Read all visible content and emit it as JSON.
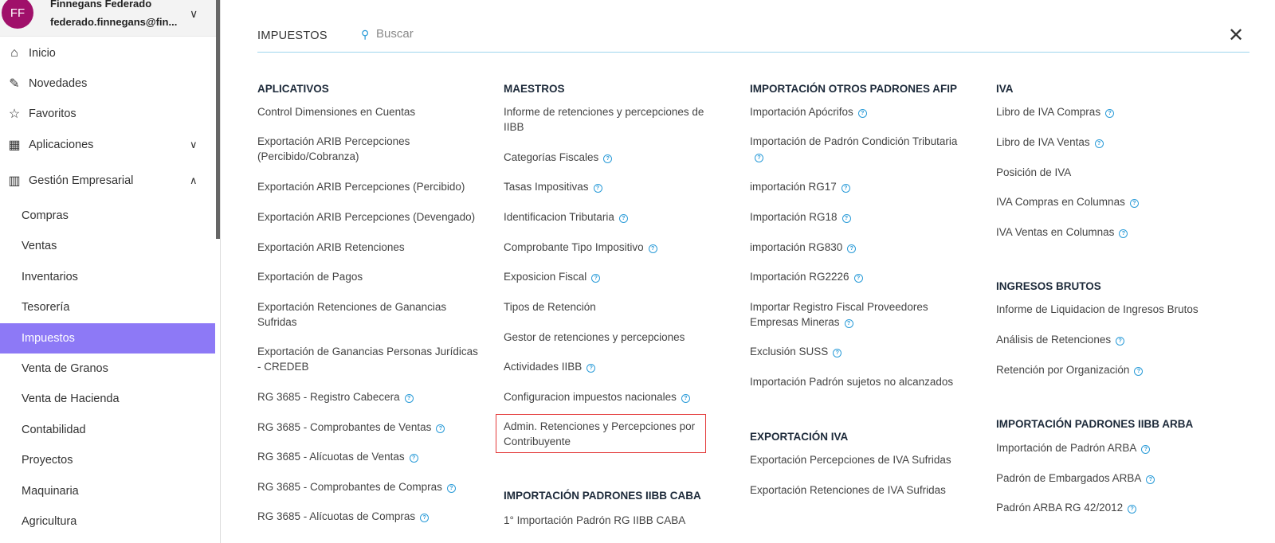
{
  "user": {
    "initials": "FF",
    "name": "Finnegans Federado",
    "email": "federado.finnegans@fin..."
  },
  "nav": [
    {
      "label": "Inicio",
      "icon": "home-icon",
      "glyph": "⌂"
    },
    {
      "label": "Novedades",
      "icon": "pin-icon",
      "glyph": "✎"
    },
    {
      "label": "Favoritos",
      "icon": "star-icon",
      "glyph": "☆"
    },
    {
      "label": "Aplicaciones",
      "icon": "grid-icon",
      "glyph": "▦",
      "chev": "∨"
    },
    {
      "label": "Gestión Empresarial",
      "icon": "building-icon",
      "glyph": "▥",
      "chev": "∧"
    }
  ],
  "subnav": [
    "Compras",
    "Ventas",
    "Inventarios",
    "Tesorería",
    "Impuestos",
    "Venta de Granos",
    "Venta de Hacienda",
    "Contabilidad",
    "Proyectos",
    "Maquinaria",
    "Agricultura"
  ],
  "active_subnav": "Impuestos",
  "header": {
    "title": "IMPUESTOS",
    "search_placeholder": "Buscar",
    "close": "✕"
  },
  "columns": [
    {
      "sections": [
        {
          "title": "APLICATIVOS",
          "items": [
            {
              "label": "Control Dimensiones en Cuentas",
              "help": false
            },
            {
              "label": "Exportación ARIB Percepciones (Percibido/Cobranza)",
              "help": false
            },
            {
              "label": "Exportación ARIB Percepciones (Percibido)",
              "help": false
            },
            {
              "label": "Exportación ARIB Percepciones (Devengado)",
              "help": false
            },
            {
              "label": "Exportación ARIB Retenciones",
              "help": false
            },
            {
              "label": "Exportación de Pagos",
              "help": false
            },
            {
              "label": "Exportación Retenciones de Ganancias Sufridas",
              "help": false
            },
            {
              "label": "Exportación de Ganancias Personas Jurídicas - CREDEB",
              "help": false
            },
            {
              "label": "RG 3685 - Registro Cabecera",
              "help": true
            },
            {
              "label": "RG 3685 - Comprobantes de Ventas",
              "help": true
            },
            {
              "label": "RG 3685 - Alícuotas de Ventas",
              "help": true
            },
            {
              "label": "RG 3685 - Comprobantes de Compras",
              "help": true
            },
            {
              "label": "RG 3685 - Alícuotas de Compras",
              "help": true
            }
          ]
        }
      ]
    },
    {
      "sections": [
        {
          "title": "MAESTROS",
          "items": [
            {
              "label": "Informe de retenciones y percepciones de IIBB",
              "help": false
            },
            {
              "label": "Categorías Fiscales",
              "help": true
            },
            {
              "label": "Tasas Impositivas",
              "help": true
            },
            {
              "label": "Identificacion Tributaria",
              "help": true
            },
            {
              "label": "Comprobante Tipo Impositivo",
              "help": true
            },
            {
              "label": "Exposicion Fiscal",
              "help": true
            },
            {
              "label": "Tipos de Retención",
              "help": false
            },
            {
              "label": "Gestor de retenciones y percepciones",
              "help": false
            },
            {
              "label": "Actividades IIBB",
              "help": true
            },
            {
              "label": "Configuracion impuestos nacionales",
              "help": true
            },
            {
              "label": "Admin. Retenciones y Percepciones por Contribuyente",
              "help": false
            }
          ]
        },
        {
          "title": "IMPORTACIÓN PADRONES IIBB CABA",
          "items": [
            {
              "label": "1° Importación Padrón RG IIBB CABA",
              "help": false
            }
          ]
        }
      ]
    },
    {
      "sections": [
        {
          "title": "IMPORTACIÓN OTROS PADRONES AFIP",
          "items": [
            {
              "label": "Importación Apócrifos",
              "help": true
            },
            {
              "label": "Importación de Padrón Condición Tributaria",
              "help": true
            },
            {
              "label": "importación RG17",
              "help": true
            },
            {
              "label": "Importación RG18",
              "help": true
            },
            {
              "label": "importación RG830",
              "help": true
            },
            {
              "label": "Importación RG2226",
              "help": true
            },
            {
              "label": "Importar Registro Fiscal Proveedores Empresas Mineras",
              "help": true
            },
            {
              "label": "Exclusión SUSS",
              "help": true
            },
            {
              "label": "Importación Padrón sujetos no alcanzados",
              "help": false
            }
          ]
        },
        {
          "title": "EXPORTACIÓN IVA",
          "items": [
            {
              "label": "Exportación Percepciones de IVA Sufridas",
              "help": false
            },
            {
              "label": "Exportación Retenciones de IVA Sufridas",
              "help": false
            }
          ]
        }
      ]
    },
    {
      "sections": [
        {
          "title": "IVA",
          "items": [
            {
              "label": "Libro de IVA Compras",
              "help": true
            },
            {
              "label": "Libro de IVA Ventas",
              "help": true
            },
            {
              "label": "Posición de IVA",
              "help": false
            },
            {
              "label": "IVA Compras en Columnas",
              "help": true
            },
            {
              "label": "IVA Ventas en Columnas",
              "help": true
            }
          ]
        },
        {
          "title": "INGRESOS BRUTOS",
          "items": [
            {
              "label": "Informe de Liquidacion de Ingresos Brutos",
              "help": false
            },
            {
              "label": "Análisis de Retenciones",
              "help": true
            },
            {
              "label": "Retención por Organización",
              "help": true
            }
          ]
        },
        {
          "title": "IMPORTACIÓN PADRONES IIBB ARBA",
          "items": [
            {
              "label": "Importación de Padrón ARBA",
              "help": true
            },
            {
              "label": "Padrón de Embargados ARBA",
              "help": true
            },
            {
              "label": "Padrón ARBA RG 42/2012",
              "help": true
            }
          ]
        }
      ]
    }
  ],
  "highlighted_item": "Admin. Retenciones y Percepciones por Contribuyente",
  "colors": {
    "accent": "#8d79f6",
    "avatar": "#a0106a",
    "link_blue": "#2a9bd8",
    "highlight_border": "#e43a3a"
  }
}
